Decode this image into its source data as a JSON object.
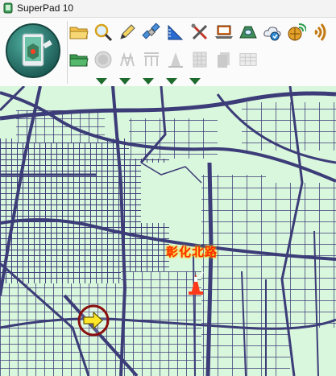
{
  "window": {
    "title": "SuperPad 10"
  },
  "toolbar": {
    "logo": "gps-tablet-logo-icon",
    "row1": [
      {
        "icon": "open-folder-icon"
      },
      {
        "icon": "search-icon"
      },
      {
        "icon": "pen-icon"
      },
      {
        "icon": "satellite-icon"
      },
      {
        "icon": "ruler-icon"
      },
      {
        "icon": "tools-icon"
      },
      {
        "icon": "laptop-icon"
      },
      {
        "icon": "map-view-icon"
      },
      {
        "icon": "cloud-sync-icon"
      },
      {
        "icon": "globe-signal-icon"
      },
      {
        "icon": "broadcast-icon"
      }
    ],
    "row2": [
      {
        "icon": "folder-icon",
        "enabled": true
      },
      {
        "icon": "record-icon",
        "enabled": false
      },
      {
        "icon": "survey-point-icon",
        "enabled": false
      },
      {
        "icon": "survey-line-icon",
        "enabled": false
      },
      {
        "icon": "cone-icon",
        "enabled": false
      },
      {
        "icon": "grid-doc-icon",
        "enabled": false
      },
      {
        "icon": "document-icon",
        "enabled": false
      },
      {
        "icon": "table-icon",
        "enabled": false
      }
    ],
    "dropdown_arrow_count": 5
  },
  "map": {
    "place_label": "彰化北路",
    "background_color": "#d9f7dc",
    "road_color": "#3c3c78",
    "marker_color": "#ff2a00"
  }
}
